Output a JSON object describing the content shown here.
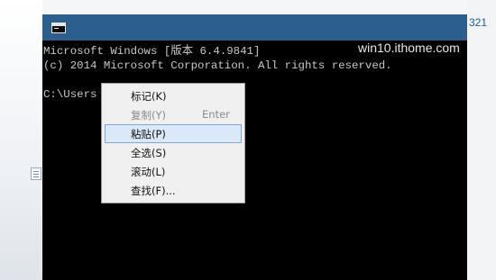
{
  "desktop": {
    "right_edge_text": "321"
  },
  "console": {
    "icon": "console-app-icon",
    "watermark": "win10.ithome.com",
    "lines": [
      "Microsoft Windows [版本 6.4.9841]",
      "(c) 2014 Microsoft Corporation. All rights reserved.",
      "",
      "C:\\Users"
    ]
  },
  "context_menu": {
    "items": [
      {
        "label": "标记(K)",
        "shortcut": "",
        "state": "normal"
      },
      {
        "label": "复制(Y)",
        "shortcut": "Enter",
        "state": "disabled"
      },
      {
        "label": "粘贴(P)",
        "shortcut": "",
        "state": "highlighted"
      },
      {
        "label": "全选(S)",
        "shortcut": "",
        "state": "normal"
      },
      {
        "label": "滚动(L)",
        "shortcut": "",
        "state": "normal"
      },
      {
        "label": "查找(F)...",
        "shortcut": "",
        "state": "normal"
      }
    ]
  },
  "colors": {
    "titlebar": "#2c5f8e",
    "console_bg": "#000000",
    "console_text": "#c8c8c8",
    "menu_highlight": "#dbe8f8"
  }
}
